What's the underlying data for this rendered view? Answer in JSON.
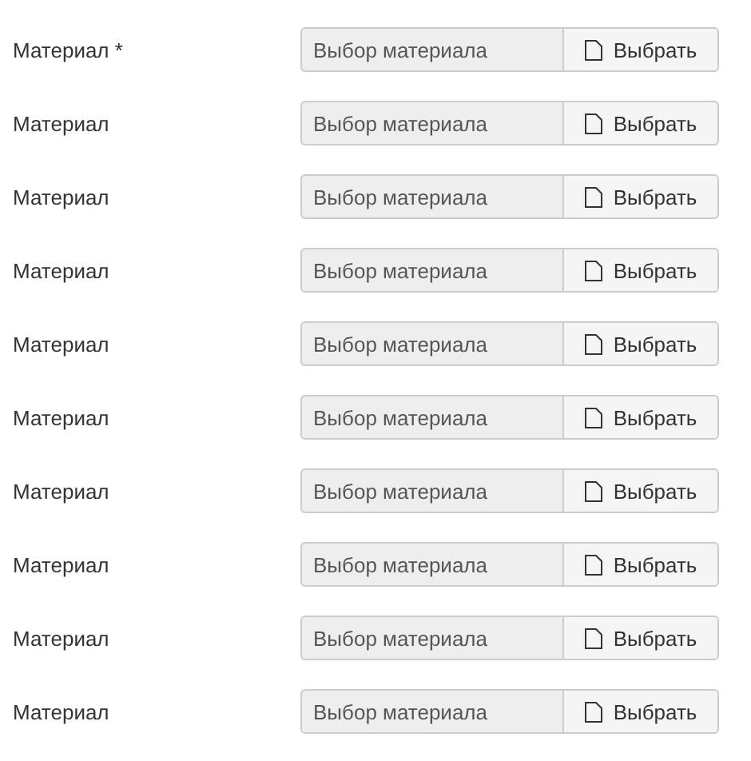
{
  "fields": [
    {
      "label": "Материал *",
      "value": "Выбор материала",
      "readonly": true,
      "button": "Выбрать"
    },
    {
      "label": "Материал",
      "value": "Выбор материала",
      "readonly": true,
      "button": "Выбрать"
    },
    {
      "label": "Материал",
      "value": "Выбор материала",
      "readonly": true,
      "button": "Выбрать"
    },
    {
      "label": "Материал",
      "value": "Выбор материала",
      "readonly": true,
      "button": "Выбрать"
    },
    {
      "label": "Материал",
      "value": "Выбор материала",
      "readonly": true,
      "button": "Выбрать"
    },
    {
      "label": "Материал",
      "value": "Выбор материала",
      "readonly": true,
      "button": "Выбрать"
    },
    {
      "label": "Материал",
      "value": "Выбор материала",
      "readonly": true,
      "button": "Выбрать"
    },
    {
      "label": "Материал",
      "value": "Выбор материала",
      "readonly": true,
      "button": "Выбрать"
    },
    {
      "label": "Материал",
      "value": "Выбор материала",
      "readonly": true,
      "button": "Выбрать"
    },
    {
      "label": "Материал",
      "value": "Выбор материала",
      "readonly": true,
      "button": "Выбрать"
    }
  ]
}
